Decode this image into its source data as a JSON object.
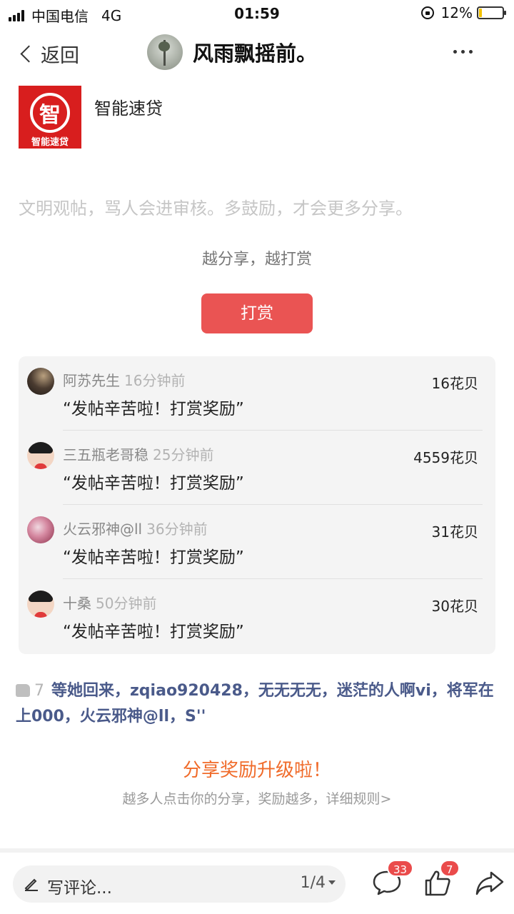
{
  "status_bar": {
    "carrier": "中国电信",
    "network": "4G",
    "time": "01:59",
    "battery_pct": "12%",
    "battery_level": 0.12
  },
  "nav": {
    "back_label": "返回",
    "title": "风雨飘摇前。"
  },
  "app": {
    "logo_glyph": "智",
    "logo_caption": "智能速贷",
    "name": "智能速贷"
  },
  "notice": "文明观帖，骂人会进审核。多鼓励，才会更多分享。",
  "reward_hint": "越分享，越打赏",
  "reward_button": "打赏",
  "rewards": [
    {
      "user": "阿苏先生",
      "time": "16分钟前",
      "message": "“发帖辛苦啦！打赏奖励”",
      "amount": "16花贝"
    },
    {
      "user": "三五瓶老哥稳",
      "time": "25分钟前",
      "message": "“发帖辛苦啦！打赏奖励”",
      "amount": "4559花贝"
    },
    {
      "user": "火云邪神@ll",
      "time": "36分钟前",
      "message": "“发帖辛苦啦！打赏奖励”",
      "amount": "31花贝"
    },
    {
      "user": "十桑",
      "time": "50分钟前",
      "message": "“发帖辛苦啦！打赏奖励”",
      "amount": "30花贝"
    }
  ],
  "likes": {
    "count": "7",
    "users": "等她回来，zqiao920428，无无无无，迷茫的人啊vi，将军在上000，火云邪神@ll，S''"
  },
  "share": {
    "title": "分享奖励升级啦！",
    "subtitle": "越多人点击你的分享，奖励越多，详细规则>"
  },
  "bottom": {
    "comment_placeholder": "写评论...",
    "page_indicator": "1/4",
    "comment_badge": "33",
    "like_badge": "7"
  }
}
